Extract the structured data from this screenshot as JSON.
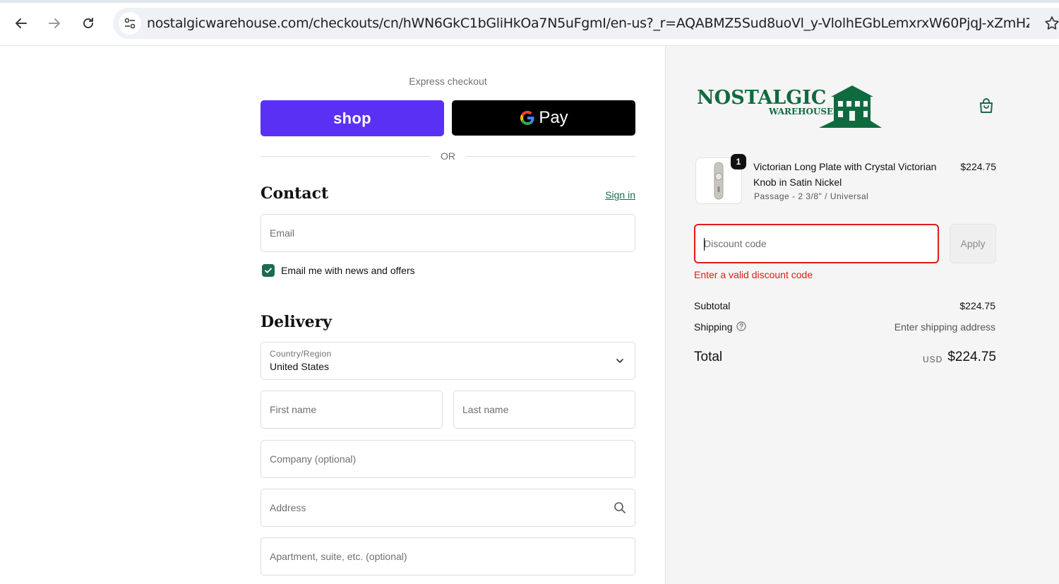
{
  "browser": {
    "url": "nostalgicwarehouse.com/checkouts/cn/hWN6GkC1bGliHkOa7N5uFgmI/en-us?_r=AQABMZ5Sud8uoVl_y-VlolhEGbLemxrxW60PjqJ-xZmHZyo&auto_redi..."
  },
  "express": {
    "label": "Express checkout",
    "shop_label": "shop",
    "gpay_label": "Pay",
    "or_label": "OR"
  },
  "contact": {
    "heading": "Contact",
    "sign_in": "Sign in",
    "email_placeholder": "Email",
    "news_label": "Email me with news and offers",
    "news_checked": true
  },
  "delivery": {
    "heading": "Delivery",
    "country_label": "Country/Region",
    "country_value": "United States",
    "first_name_placeholder": "First name",
    "last_name_placeholder": "Last name",
    "company_placeholder": "Company (optional)",
    "address_placeholder": "Address",
    "apartment_placeholder": "Apartment, suite, etc. (optional)"
  },
  "summary": {
    "logo_text": "NOSTALGIC",
    "logo_sub": "WAREHOUSE",
    "item": {
      "quantity": "1",
      "title": "Victorian Long Plate with Crystal Victorian Knob in Satin Nickel",
      "variant": "Passage - 2 3/8\" / Universal",
      "price": "$224.75"
    },
    "discount_placeholder": "Discount code",
    "apply_label": "Apply",
    "discount_error": "Enter a valid discount code",
    "subtotal_label": "Subtotal",
    "subtotal_value": "$224.75",
    "shipping_label": "Shipping",
    "shipping_value": "Enter shipping address",
    "total_label": "Total",
    "total_currency": "USD",
    "total_value": "$224.75"
  },
  "colors": {
    "shop_purple": "#5a31f4",
    "accent_green": "#1b6b4e",
    "error_red": "#dd1d1d",
    "logo_green": "#0f6b3f"
  }
}
